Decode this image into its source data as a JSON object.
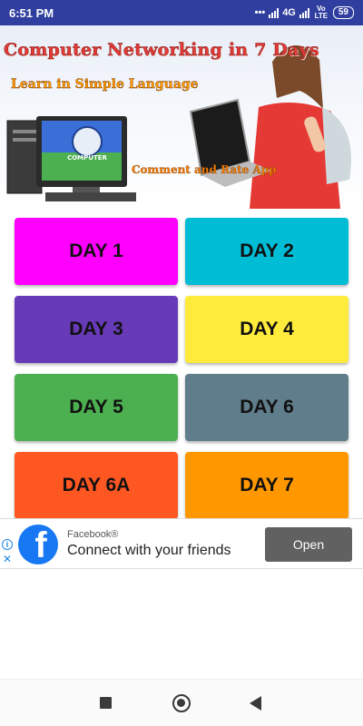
{
  "status_bar": {
    "time": "6:51 PM",
    "dots": "•••",
    "network": "4G",
    "volte": "Vo LTE",
    "battery": "59"
  },
  "banner": {
    "title": "Computer Networking in 7 Days",
    "subtitle": "Learn in Simple Language",
    "cta": "Comment and Rate App",
    "monitor_text": "COMPUTER"
  },
  "days": [
    {
      "label": "DAY 1",
      "color": "#ff00ff"
    },
    {
      "label": "DAY 2",
      "color": "#00bcd4"
    },
    {
      "label": "DAY 3",
      "color": "#673ab7"
    },
    {
      "label": "DAY 4",
      "color": "#ffeb3b"
    },
    {
      "label": "DAY 5",
      "color": "#4caf50"
    },
    {
      "label": "DAY 6",
      "color": "#607d8b"
    },
    {
      "label": "DAY 6A",
      "color": "#ff5722"
    },
    {
      "label": "DAY 7",
      "color": "#ff9800"
    }
  ],
  "ad": {
    "brand": "Facebook®",
    "text": "Connect with your friends",
    "button": "Open",
    "info_icon": "i",
    "close_icon": "✕"
  }
}
